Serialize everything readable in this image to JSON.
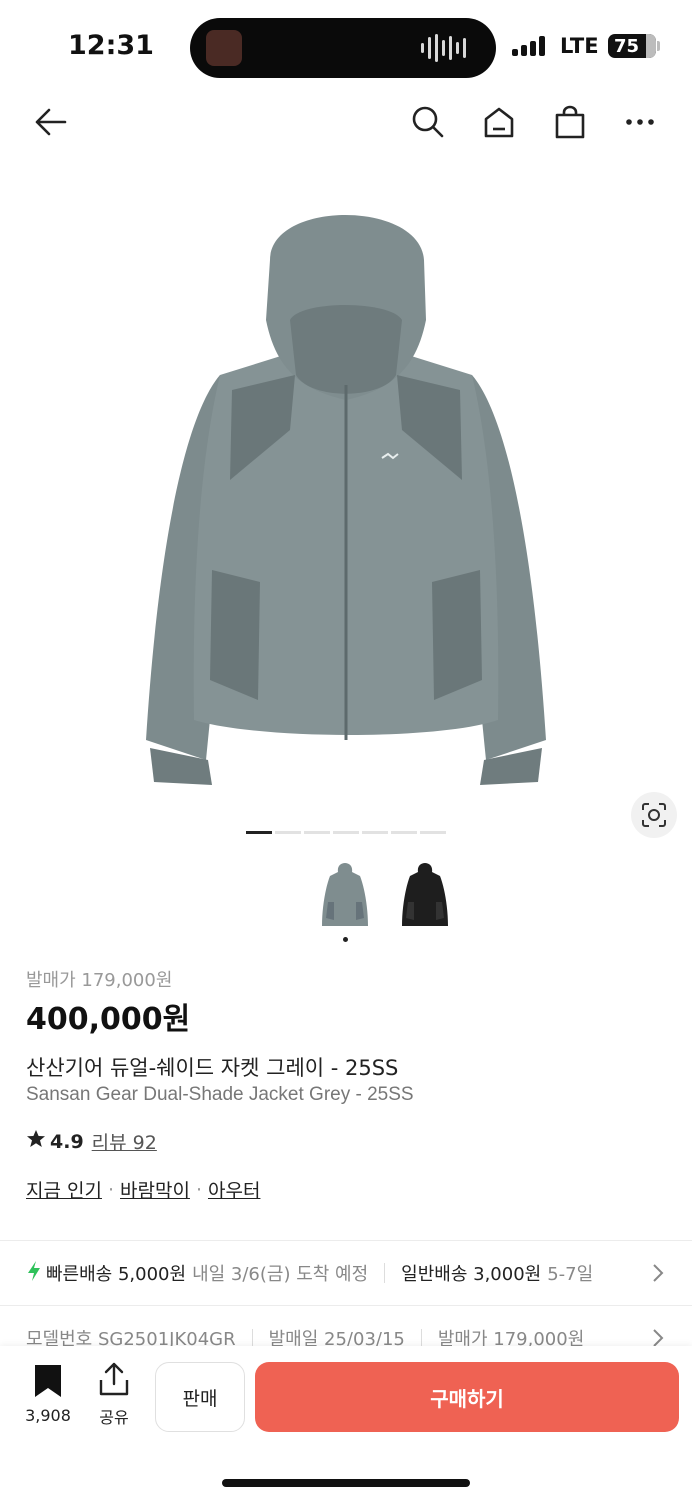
{
  "status": {
    "time": "12:31",
    "network": "LTE",
    "battery": "75"
  },
  "nav": {
    "icons": [
      "back-arrow-icon",
      "search-icon",
      "home-icon",
      "shopping-bag-icon",
      "more-icon"
    ]
  },
  "gallery": {
    "page_count": 7,
    "active_page": 1,
    "thumbnails": [
      "grey",
      "black"
    ]
  },
  "product": {
    "release_price": "발매가 179,000원",
    "price": "400,000원",
    "name_ko": "산산기어 듀얼-쉐이드 자켓 그레이 - 25SS",
    "name_en": "Sansan Gear Dual-Shade Jacket Grey - 25SS",
    "rating": "4.9",
    "review_label": "리뷰 92",
    "tags": [
      "지금 인기",
      "바람막이",
      "아우터"
    ]
  },
  "delivery": {
    "fast_label": "빠른배송 5,000원",
    "fast_eta": "내일 3/6(금) 도착 예정",
    "normal_label": "일반배송 3,000원",
    "normal_eta": "5-7일"
  },
  "info_row": {
    "model": "모델번호 SG2501JK04GR",
    "release_date": "발매일 25/03/15",
    "release_price": "발매가 179,000원"
  },
  "bottom": {
    "bookmark_count": "3,908",
    "share_label": "공유",
    "sell_label": "판매",
    "buy_label": "구매하기"
  },
  "colors": {
    "accent": "#ef6253",
    "fast_delivery": "#2ec15a"
  }
}
